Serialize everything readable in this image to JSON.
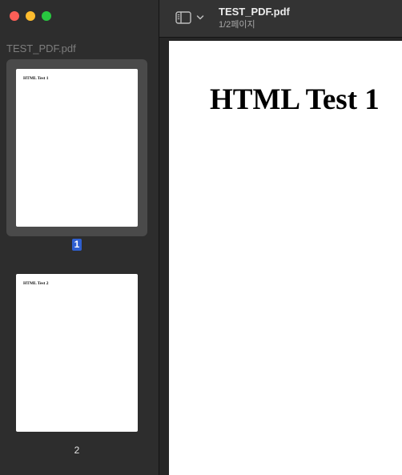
{
  "window": {
    "title": "TEST_PDF.pdf",
    "subtitle": "1/2페이지"
  },
  "sidebar": {
    "title": "TEST_PDF.pdf",
    "thumbnails": [
      {
        "page_label": "1",
        "text": "HTML Test 1",
        "selected": true
      },
      {
        "page_label": "2",
        "text": "HTML Test 2",
        "selected": false
      }
    ]
  },
  "toolbar": {
    "sidebar_toggle_icon": "sidebar-icon",
    "dropdown_icon": "chevron-down-icon"
  },
  "document": {
    "heading": "HTML Test 1"
  },
  "colors": {
    "close": "#fe5f57",
    "minimize": "#febc2e",
    "maximize": "#28c840",
    "selection": "#2f5fcf"
  }
}
